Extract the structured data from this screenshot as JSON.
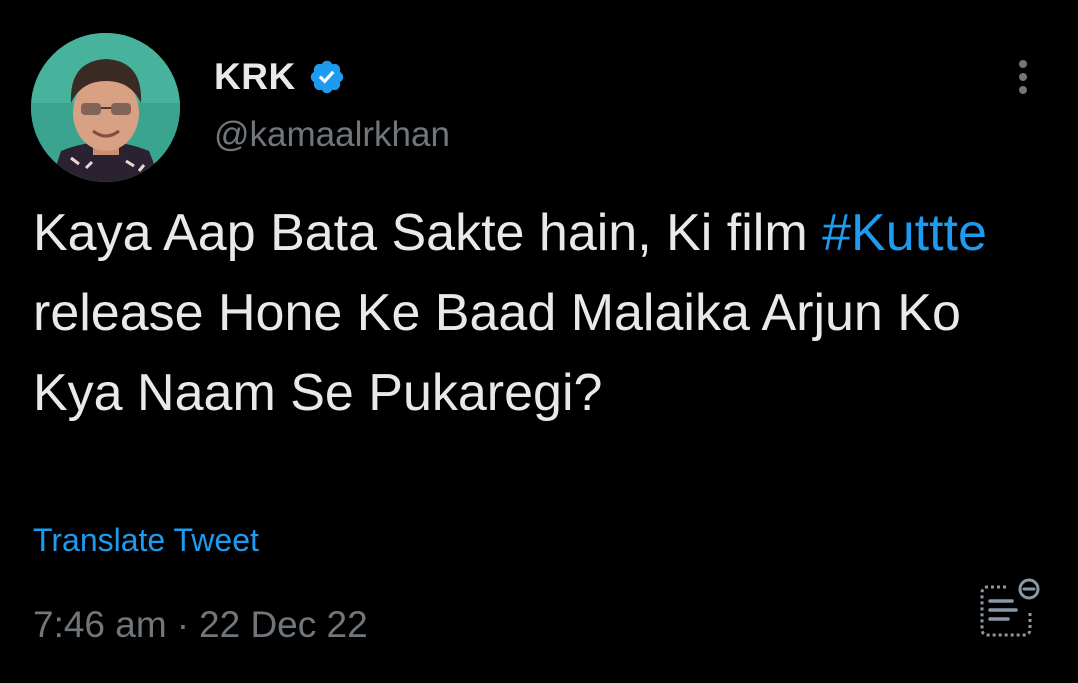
{
  "author": {
    "display_name": "KRK",
    "handle": "@kamaalrkhan",
    "verified": true
  },
  "tweet": {
    "text_before": "Kaya Aap Bata Sakte hain, Ki film ",
    "hashtag": "#Kuttte",
    "text_after": " release Hone Ke Baad Malaika Arjun Ko Kya Naam Se Pukaregi?",
    "translate_label": "Translate Tweet",
    "time": "7:46 am",
    "separator": "·",
    "date": "22 Dec 22"
  },
  "icons": {
    "verified": "verified-badge-icon",
    "more": "more-vertical-icon",
    "analytics": "tweet-analytics-icon"
  },
  "colors": {
    "background": "#000000",
    "primary_text": "#e7e9ea",
    "secondary_text": "#71767b",
    "accent": "#1d9bf0"
  }
}
